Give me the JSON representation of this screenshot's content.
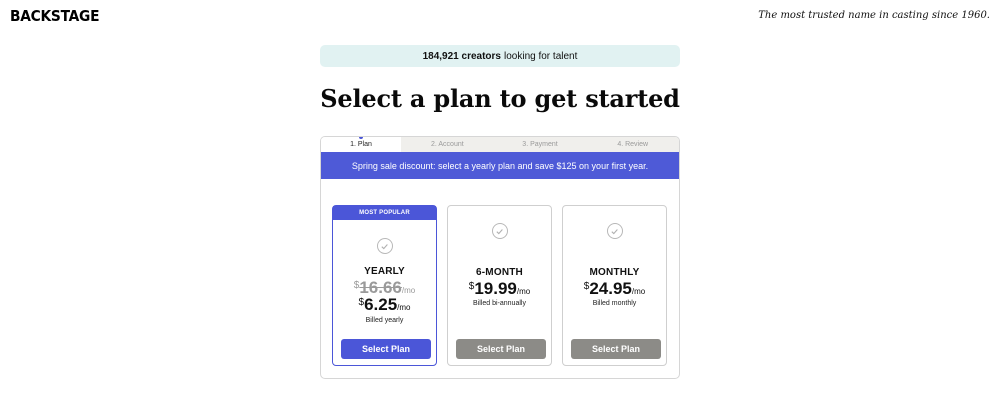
{
  "header": {
    "logo": "BACKSTAGE",
    "tagline": "The most trusted name in casting since 1960."
  },
  "banner": {
    "count": "184,921 creators",
    "text": "looking for talent"
  },
  "headline": "Select a plan to get started",
  "steps": [
    {
      "label": "1. Plan",
      "active": true
    },
    {
      "label": "2. Account",
      "active": false
    },
    {
      "label": "3. Payment",
      "active": false
    },
    {
      "label": "4. Review",
      "active": false
    }
  ],
  "promo": "Spring sale discount: select a yearly plan and save $125 on your first year.",
  "plans": [
    {
      "badge": "MOST POPULAR",
      "name": "YEARLY",
      "old_currency": "$",
      "old_price": "16.66",
      "old_per": "/mo",
      "currency": "$",
      "price": "6.25",
      "per": "/mo",
      "billing": "Billed yearly",
      "button": "Select Plan"
    },
    {
      "name": "6-MONTH",
      "currency": "$",
      "price": "19.99",
      "per": "/mo",
      "billing": "Billed bi-annually",
      "button": "Select Plan"
    },
    {
      "name": "MONTHLY",
      "currency": "$",
      "price": "24.95",
      "per": "/mo",
      "billing": "Billed monthly",
      "button": "Select Plan"
    }
  ],
  "colors": {
    "accent": "#4b56d8",
    "banner_bg": "#e1f2f2",
    "secondary_button": "#8c8b87"
  },
  "icons": {
    "plan_check": "check-circle-icon"
  }
}
